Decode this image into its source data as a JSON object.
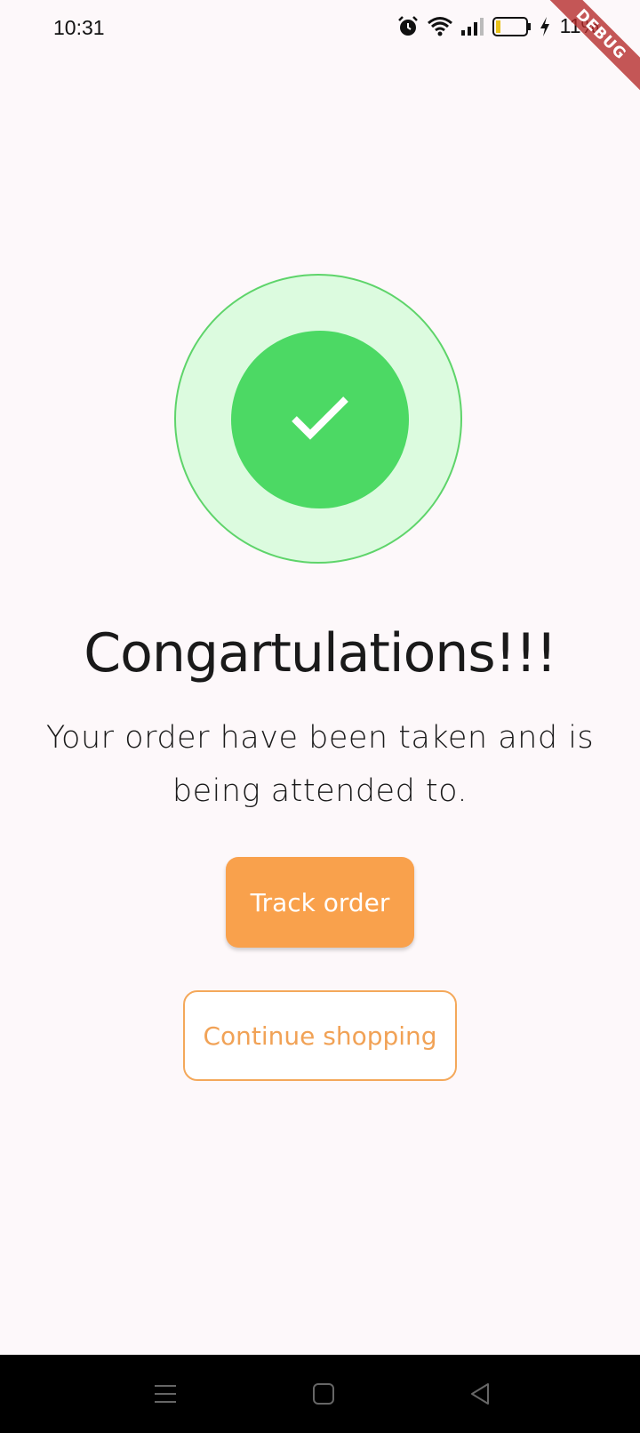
{
  "status_bar": {
    "time": "10:31",
    "battery_percent": "11%",
    "icons": [
      "alarm-icon",
      "wifi-icon",
      "signal-icon",
      "battery-icon",
      "charging-icon"
    ]
  },
  "debug_banner": "DEBUG",
  "success": {
    "icon": "checkmark-icon",
    "outer_color": "#dcfbdf",
    "inner_color": "#4cd964"
  },
  "title": "Congartulations!!!",
  "message": "Your order have been taken and is being attended to.",
  "buttons": {
    "track_order": "Track order",
    "continue_shopping": "Continue shopping"
  },
  "colors": {
    "accent": "#f9a14c",
    "success": "#4cd964"
  },
  "nav_bar": {
    "icons": [
      "menu-icon",
      "home-icon",
      "back-icon"
    ]
  }
}
